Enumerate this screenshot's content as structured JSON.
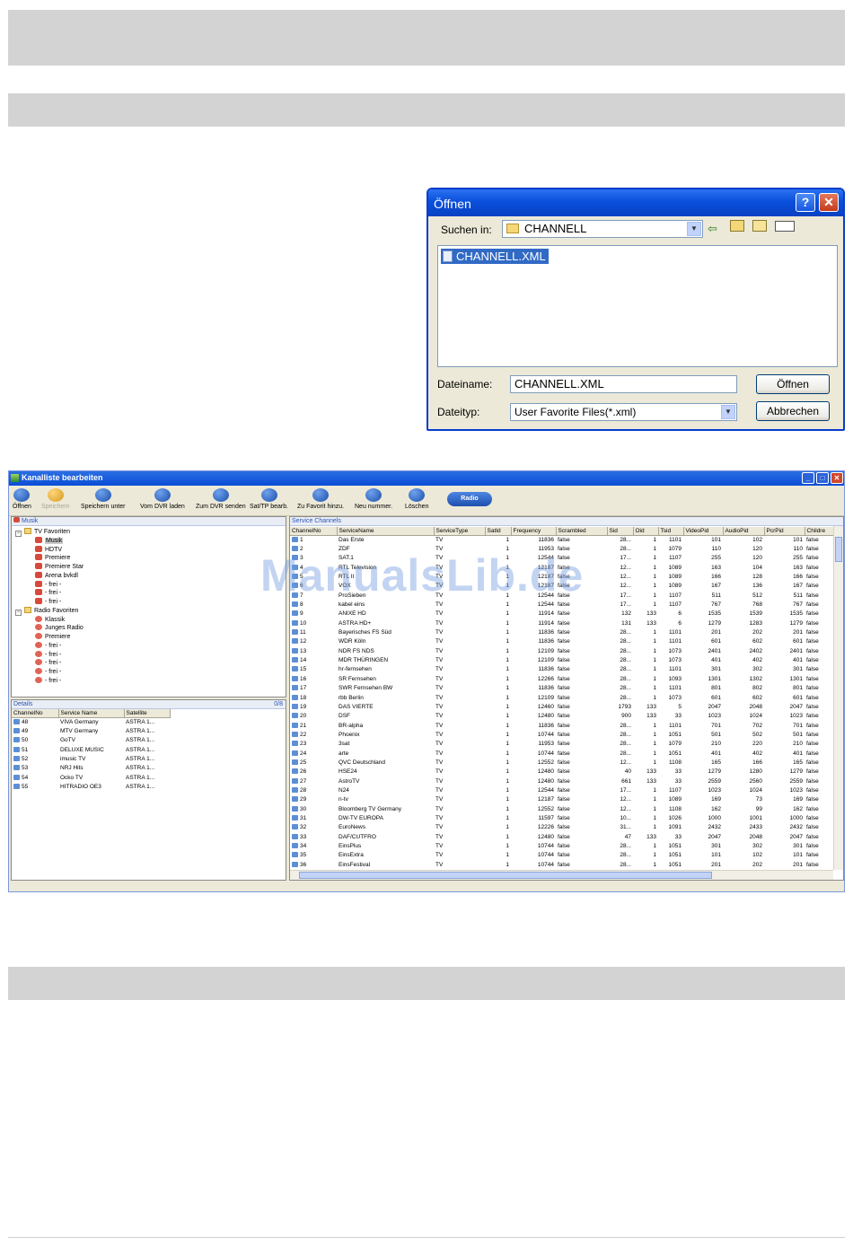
{
  "open_dialog": {
    "title": "Öffnen",
    "help_btn": "?",
    "close_btn": "✕",
    "lookin_label": "Suchen in:",
    "lookin_value": "CHANNELL",
    "selected_file": "CHANNELL.XML",
    "filename_label": "Dateiname:",
    "filename_value": "CHANNELL.XML",
    "filetype_label": "Dateityp:",
    "filetype_value": "User Favorite Files(*.xml)",
    "open_btn": "Öffnen",
    "cancel_btn": "Abbrechen"
  },
  "app": {
    "title": "Kanalliste bearbeiten",
    "toolbar": [
      {
        "label": "Öffnen",
        "icon": "folder-icon",
        "enabled": true
      },
      {
        "label": "Speichern",
        "icon": "save-icon",
        "enabled": false
      },
      {
        "label": "Speichern unter",
        "icon": "save-as-icon",
        "enabled": true
      },
      {
        "label": "Vom DVR laden",
        "icon": "download-icon",
        "enabled": true
      },
      {
        "label": "Zum DVR senden",
        "icon": "upload-icon",
        "enabled": true
      },
      {
        "label": "Sat/TP bearb.",
        "icon": "satellite-icon",
        "enabled": true
      },
      {
        "label": "Zu Favorit hinzu.",
        "icon": "favorite-add-icon",
        "enabled": true
      },
      {
        "label": "Neu nummer.",
        "icon": "renumber-icon",
        "enabled": true
      },
      {
        "label": "Löschen",
        "icon": "delete-icon",
        "enabled": true
      }
    ],
    "radio_btn": "Radio",
    "tree_header": "Musik",
    "tree": [
      {
        "label": "TV Favoriten",
        "level": 0,
        "type": "folder"
      },
      {
        "label": "Musik",
        "level": 1,
        "type": "tv",
        "selected": true
      },
      {
        "label": "HDTV",
        "level": 1,
        "type": "tv"
      },
      {
        "label": "Premiere",
        "level": 1,
        "type": "tv"
      },
      {
        "label": "Premiere Star",
        "level": 1,
        "type": "tv"
      },
      {
        "label": "Arena bvkdl",
        "level": 1,
        "type": "tv"
      },
      {
        "label": "- frei -",
        "level": 1,
        "type": "tv"
      },
      {
        "label": "- frei -",
        "level": 1,
        "type": "tv"
      },
      {
        "label": "- frei -",
        "level": 1,
        "type": "tv"
      },
      {
        "label": "Radio Favoriten",
        "level": 0,
        "type": "folder"
      },
      {
        "label": "Klassik",
        "level": 1,
        "type": "radio"
      },
      {
        "label": "Junges Radio",
        "level": 1,
        "type": "radio"
      },
      {
        "label": "Premiere",
        "level": 1,
        "type": "radio"
      },
      {
        "label": "- frei -",
        "level": 1,
        "type": "radio"
      },
      {
        "label": "- frei -",
        "level": 1,
        "type": "radio"
      },
      {
        "label": "- frei -",
        "level": 1,
        "type": "radio"
      },
      {
        "label": "- frei -",
        "level": 1,
        "type": "radio"
      },
      {
        "label": "- frei -",
        "level": 1,
        "type": "radio"
      }
    ],
    "details": {
      "header": "Details",
      "count": "0/8",
      "columns": [
        "ChannelNo",
        "Service Name",
        "Satellite"
      ],
      "rows": [
        [
          "48",
          "VIVA Germany",
          "ASTRA 1..."
        ],
        [
          "49",
          "MTV Germany",
          "ASTRA 1..."
        ],
        [
          "50",
          "GoTV",
          "ASTRA 1..."
        ],
        [
          "51",
          "DELUXE MUSIC",
          "ASTRA 1..."
        ],
        [
          "52",
          "imusic TV",
          "ASTRA 1..."
        ],
        [
          "53",
          "NRJ Hits",
          "ASTRA 1..."
        ],
        [
          "54",
          "Ocko TV",
          "ASTRA 1..."
        ],
        [
          "55",
          "HITRADIO OE3",
          "ASTRA 1..."
        ]
      ]
    },
    "service_channels": {
      "header": "Service Channels",
      "columns": [
        "ChannelNo",
        "ServiceName",
        "ServiceType",
        "SatId",
        "Frequency",
        "Scrambled",
        "Sid",
        "Oid",
        "Tsid",
        "VideoPid",
        "AudioPid",
        "PcrPid",
        "Childre"
      ],
      "rows": [
        [
          "1",
          "Das Erste",
          "TV",
          "1",
          "11836",
          "false",
          "28...",
          "1",
          "1101",
          "101",
          "102",
          "101",
          "false"
        ],
        [
          "2",
          "ZDF",
          "TV",
          "1",
          "11953",
          "false",
          "28...",
          "1",
          "1079",
          "110",
          "120",
          "110",
          "false"
        ],
        [
          "3",
          "SAT.1",
          "TV",
          "1",
          "12544",
          "false",
          "17...",
          "1",
          "1107",
          "255",
          "120",
          "255",
          "false"
        ],
        [
          "4",
          "RTL Television",
          "TV",
          "1",
          "12187",
          "false",
          "12...",
          "1",
          "1089",
          "163",
          "104",
          "163",
          "false"
        ],
        [
          "5",
          "RTL II",
          "TV",
          "1",
          "12187",
          "false",
          "12...",
          "1",
          "1089",
          "166",
          "128",
          "166",
          "false"
        ],
        [
          "6",
          "VOX",
          "TV",
          "1",
          "12187",
          "false",
          "12...",
          "1",
          "1089",
          "167",
          "136",
          "167",
          "false"
        ],
        [
          "7",
          "ProSieben",
          "TV",
          "1",
          "12544",
          "false",
          "17...",
          "1",
          "1107",
          "511",
          "512",
          "511",
          "false"
        ],
        [
          "8",
          "kabel eins",
          "TV",
          "1",
          "12544",
          "false",
          "17...",
          "1",
          "1107",
          "767",
          "768",
          "767",
          "false"
        ],
        [
          "9",
          "ANIXE HD",
          "TV",
          "1",
          "11914",
          "false",
          "132",
          "133",
          "6",
          "1535",
          "1539",
          "1535",
          "false"
        ],
        [
          "10",
          "ASTRA HD+",
          "TV",
          "1",
          "11914",
          "false",
          "131",
          "133",
          "6",
          "1279",
          "1283",
          "1279",
          "false"
        ],
        [
          "11",
          "Bayerisches FS Süd",
          "TV",
          "1",
          "11836",
          "false",
          "28...",
          "1",
          "1101",
          "201",
          "202",
          "201",
          "false"
        ],
        [
          "12",
          "WDR Köln",
          "TV",
          "1",
          "11836",
          "false",
          "28...",
          "1",
          "1101",
          "601",
          "602",
          "601",
          "false"
        ],
        [
          "13",
          "NDR FS NDS",
          "TV",
          "1",
          "12109",
          "false",
          "28...",
          "1",
          "1073",
          "2401",
          "2402",
          "2401",
          "false"
        ],
        [
          "14",
          "MDR THÜRINGEN",
          "TV",
          "1",
          "12109",
          "false",
          "28...",
          "1",
          "1073",
          "401",
          "402",
          "401",
          "false"
        ],
        [
          "15",
          "hr-fernsehen",
          "TV",
          "1",
          "11836",
          "false",
          "28...",
          "1",
          "1101",
          "301",
          "302",
          "301",
          "false"
        ],
        [
          "16",
          "SR Fernsehen",
          "TV",
          "1",
          "12266",
          "false",
          "28...",
          "1",
          "1093",
          "1301",
          "1302",
          "1301",
          "false"
        ],
        [
          "17",
          "SWR Fernsehen BW",
          "TV",
          "1",
          "11836",
          "false",
          "28...",
          "1",
          "1101",
          "801",
          "802",
          "801",
          "false"
        ],
        [
          "18",
          "rbb Berlin",
          "TV",
          "1",
          "12109",
          "false",
          "28...",
          "1",
          "1073",
          "601",
          "602",
          "601",
          "false"
        ],
        [
          "19",
          "DAS VIERTE",
          "TV",
          "1",
          "12460",
          "false",
          "1793",
          "133",
          "5",
          "2047",
          "2048",
          "2047",
          "false"
        ],
        [
          "20",
          "DSF",
          "TV",
          "1",
          "12480",
          "false",
          "900",
          "133",
          "33",
          "1023",
          "1024",
          "1023",
          "false"
        ],
        [
          "21",
          "BR-alpha",
          "TV",
          "1",
          "11836",
          "false",
          "28...",
          "1",
          "1101",
          "701",
          "702",
          "701",
          "false"
        ],
        [
          "22",
          "Phoenix",
          "TV",
          "1",
          "10744",
          "false",
          "28...",
          "1",
          "1051",
          "501",
          "502",
          "501",
          "false"
        ],
        [
          "23",
          "3sat",
          "TV",
          "1",
          "11953",
          "false",
          "28...",
          "1",
          "1079",
          "210",
          "220",
          "210",
          "false"
        ],
        [
          "24",
          "arte",
          "TV",
          "1",
          "10744",
          "false",
          "28...",
          "1",
          "1051",
          "401",
          "402",
          "401",
          "false"
        ],
        [
          "25",
          "QVC Deutschland",
          "TV",
          "1",
          "12552",
          "false",
          "12...",
          "1",
          "1108",
          "165",
          "166",
          "165",
          "false"
        ],
        [
          "26",
          "HSE24",
          "TV",
          "1",
          "12480",
          "false",
          "40",
          "133",
          "33",
          "1279",
          "1280",
          "1279",
          "false"
        ],
        [
          "27",
          "AstroTV",
          "TV",
          "1",
          "12480",
          "false",
          "661",
          "133",
          "33",
          "2559",
          "2560",
          "2559",
          "false"
        ],
        [
          "28",
          "N24",
          "TV",
          "1",
          "12544",
          "false",
          "17...",
          "1",
          "1107",
          "1023",
          "1024",
          "1023",
          "false"
        ],
        [
          "29",
          "n-tv",
          "TV",
          "1",
          "12187",
          "false",
          "12...",
          "1",
          "1089",
          "169",
          "73",
          "169",
          "false"
        ],
        [
          "30",
          "Bloomberg TV Germany",
          "TV",
          "1",
          "12552",
          "false",
          "12...",
          "1",
          "1108",
          "162",
          "99",
          "162",
          "false"
        ],
        [
          "31",
          "DW-TV EUROPA",
          "TV",
          "1",
          "11597",
          "false",
          "10...",
          "1",
          "1026",
          "1000",
          "1001",
          "1000",
          "false"
        ],
        [
          "32",
          "EuroNews",
          "TV",
          "1",
          "12226",
          "false",
          "31...",
          "1",
          "1091",
          "2432",
          "2433",
          "2432",
          "false"
        ],
        [
          "33",
          "DAF/CUTFRO",
          "TV",
          "1",
          "12480",
          "false",
          "47",
          "133",
          "33",
          "2047",
          "2048",
          "2047",
          "false"
        ],
        [
          "34",
          "EinsPlus",
          "TV",
          "1",
          "10744",
          "false",
          "28...",
          "1",
          "1051",
          "301",
          "302",
          "301",
          "false"
        ],
        [
          "35",
          "EinsExtra",
          "TV",
          "1",
          "10744",
          "false",
          "28...",
          "1",
          "1051",
          "101",
          "102",
          "101",
          "false"
        ],
        [
          "36",
          "EinsFestival",
          "TV",
          "1",
          "10744",
          "false",
          "28...",
          "1",
          "1051",
          "201",
          "202",
          "201",
          "false"
        ]
      ]
    }
  },
  "watermark": "ManualsLib.de"
}
